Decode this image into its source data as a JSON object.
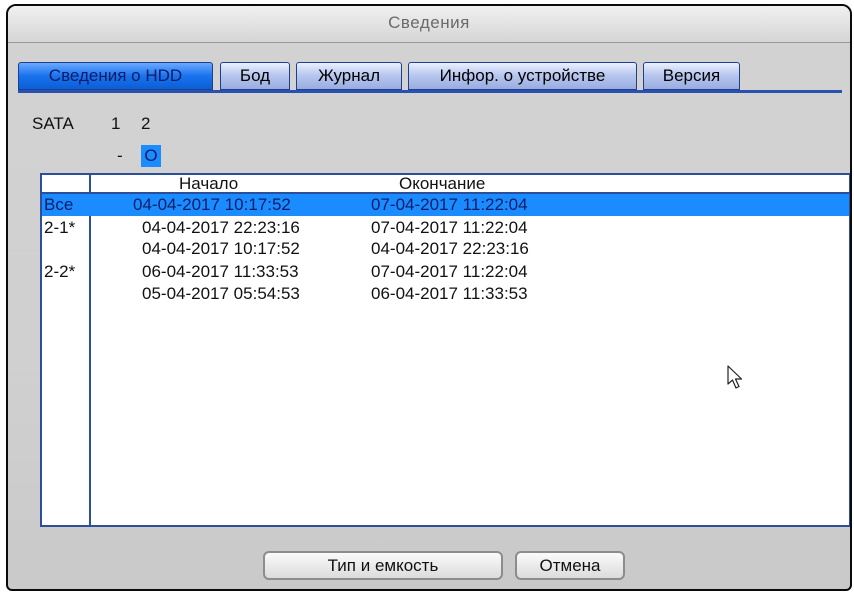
{
  "window": {
    "title": "Сведения"
  },
  "tabs": [
    {
      "label": "Сведения о HDD",
      "active": true
    },
    {
      "label": "Бод",
      "active": false
    },
    {
      "label": "Журнал",
      "active": false
    },
    {
      "label": "Инфор. о устройстве",
      "active": false
    },
    {
      "label": "Версия",
      "active": false
    }
  ],
  "sata": {
    "label": "SATA",
    "ports": [
      "1",
      "2"
    ],
    "status": [
      "-",
      "O"
    ]
  },
  "table": {
    "columns": [
      "Начало",
      "Окончание"
    ],
    "rows": [
      {
        "id": "Все",
        "start": "04-04-2017 10:17:52",
        "end": "07-04-2017 11:22:04",
        "selected": true
      },
      {
        "id": "2-1*",
        "start": "04-04-2017 22:23:16",
        "end": "07-04-2017 11:22:04",
        "selected": false
      },
      {
        "id": "",
        "start": "04-04-2017 10:17:52",
        "end": "04-04-2017 22:23:16",
        "selected": false
      },
      {
        "id": "2-2*",
        "start": "06-04-2017 11:33:53",
        "end": "07-04-2017 11:22:04",
        "selected": false
      },
      {
        "id": "",
        "start": "05-04-2017 05:54:53",
        "end": "06-04-2017 11:33:53",
        "selected": false
      }
    ]
  },
  "buttons": {
    "type_capacity": "Тип и емкость",
    "cancel": "Отмена"
  },
  "colors": {
    "selection": "#1a8cff",
    "border": "#2d4e9a",
    "active_tab": "#1a72ee"
  }
}
